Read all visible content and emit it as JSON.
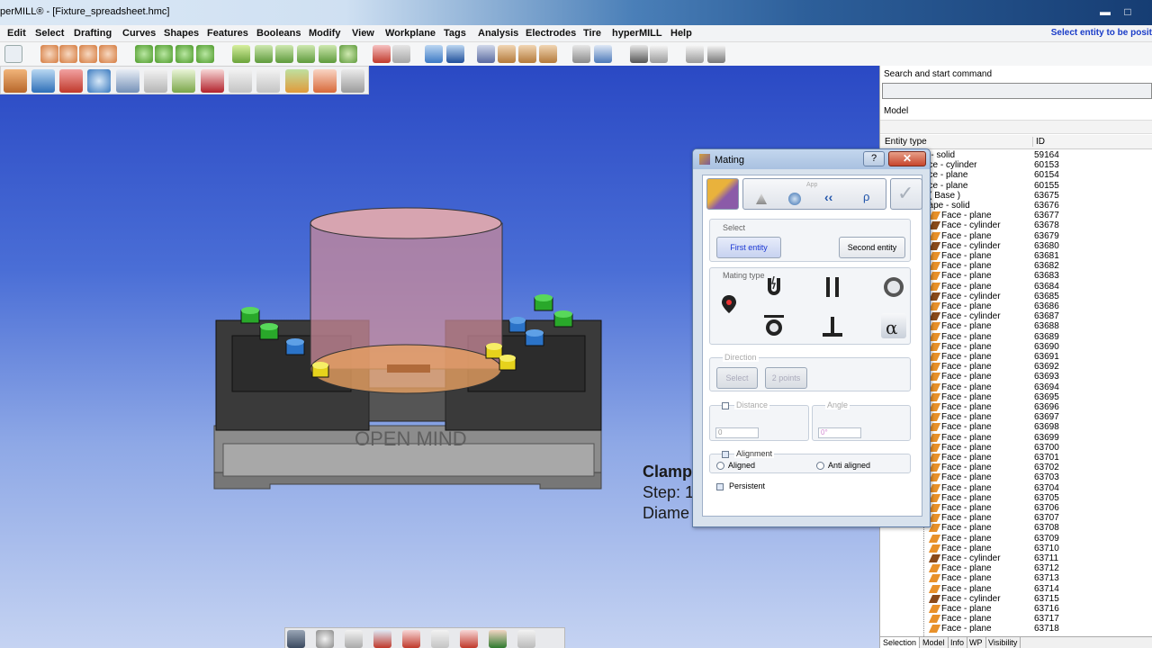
{
  "window": {
    "title": "perMILL® - [Fixture_spreadsheet.hmc]",
    "minimize": "▬",
    "maximize": "□"
  },
  "menu": {
    "items": [
      "Edit",
      "Select",
      "Drafting",
      "Curves",
      "Shapes",
      "Features",
      "Booleans",
      "Modify",
      "View",
      "Workplane",
      "Tags",
      "Analysis",
      "Electrodes",
      "Tire",
      "hyperMILL",
      "Help"
    ],
    "status_hint": "Select entity to be posit"
  },
  "viewport": {
    "model_text": "OPEN MIND",
    "overlay_lines": [
      "Clamp",
      "Step: 1",
      "Diame"
    ]
  },
  "right_panel": {
    "search_label": "Search and start command",
    "model_label": "Model",
    "columns": [
      "Entity type",
      "ID"
    ],
    "rows": [
      {
        "name": "e - solid",
        "id": "59164",
        "icon": "none"
      },
      {
        "name": "ace - cylinder",
        "id": "60153",
        "icon": "none"
      },
      {
        "name": "ace - plane",
        "id": "60154",
        "icon": "none"
      },
      {
        "name": "ace - plane",
        "id": "60155",
        "icon": "none"
      },
      {
        "name": ") ( Base )",
        "id": "63675",
        "icon": "none"
      },
      {
        "name": "hape - solid",
        "id": "63676",
        "icon": "none"
      },
      {
        "name": "Face - plane",
        "id": "63677",
        "icon": "plane"
      },
      {
        "name": "Face - cylinder",
        "id": "63678",
        "icon": "cylinder"
      },
      {
        "name": "Face - plane",
        "id": "63679",
        "icon": "plane"
      },
      {
        "name": "Face - cylinder",
        "id": "63680",
        "icon": "cylinder"
      },
      {
        "name": "Face - plane",
        "id": "63681",
        "icon": "plane"
      },
      {
        "name": "Face - plane",
        "id": "63682",
        "icon": "plane"
      },
      {
        "name": "Face - plane",
        "id": "63683",
        "icon": "plane"
      },
      {
        "name": "Face - plane",
        "id": "63684",
        "icon": "plane"
      },
      {
        "name": "Face - cylinder",
        "id": "63685",
        "icon": "cylinder"
      },
      {
        "name": "Face - plane",
        "id": "63686",
        "icon": "plane"
      },
      {
        "name": "Face - cylinder",
        "id": "63687",
        "icon": "cylinder"
      },
      {
        "name": "Face - plane",
        "id": "63688",
        "icon": "plane"
      },
      {
        "name": "Face - plane",
        "id": "63689",
        "icon": "plane"
      },
      {
        "name": "Face - plane",
        "id": "63690",
        "icon": "plane"
      },
      {
        "name": "Face - plane",
        "id": "63691",
        "icon": "plane"
      },
      {
        "name": "Face - plane",
        "id": "63692",
        "icon": "plane"
      },
      {
        "name": "Face - plane",
        "id": "63693",
        "icon": "plane"
      },
      {
        "name": "Face - plane",
        "id": "63694",
        "icon": "plane"
      },
      {
        "name": "Face - plane",
        "id": "63695",
        "icon": "plane"
      },
      {
        "name": "Face - plane",
        "id": "63696",
        "icon": "plane"
      },
      {
        "name": "Face - plane",
        "id": "63697",
        "icon": "plane"
      },
      {
        "name": "Face - plane",
        "id": "63698",
        "icon": "plane"
      },
      {
        "name": "Face - plane",
        "id": "63699",
        "icon": "plane"
      },
      {
        "name": "Face - plane",
        "id": "63700",
        "icon": "plane"
      },
      {
        "name": "Face - plane",
        "id": "63701",
        "icon": "plane"
      },
      {
        "name": "Face - plane",
        "id": "63702",
        "icon": "plane"
      },
      {
        "name": "Face - plane",
        "id": "63703",
        "icon": "plane"
      },
      {
        "name": "Face - plane",
        "id": "63704",
        "icon": "plane"
      },
      {
        "name": "Face - plane",
        "id": "63705",
        "icon": "plane"
      },
      {
        "name": "Face - plane",
        "id": "63706",
        "icon": "plane"
      },
      {
        "name": "Face - plane",
        "id": "63707",
        "icon": "plane"
      },
      {
        "name": "Face - plane",
        "id": "63708",
        "icon": "plane"
      },
      {
        "name": "Face - plane",
        "id": "63709",
        "icon": "plane"
      },
      {
        "name": "Face - plane",
        "id": "63710",
        "icon": "plane"
      },
      {
        "name": "Face - cylinder",
        "id": "63711",
        "icon": "cylinder"
      },
      {
        "name": "Face - plane",
        "id": "63712",
        "icon": "plane"
      },
      {
        "name": "Face - plane",
        "id": "63713",
        "icon": "plane"
      },
      {
        "name": "Face - plane",
        "id": "63714",
        "icon": "plane"
      },
      {
        "name": "Face - cylinder",
        "id": "63715",
        "icon": "cylinder"
      },
      {
        "name": "Face - plane",
        "id": "63716",
        "icon": "plane"
      },
      {
        "name": "Face - plane",
        "id": "63717",
        "icon": "plane"
      },
      {
        "name": "Face - plane",
        "id": "63718",
        "icon": "plane"
      }
    ],
    "tabs": [
      "Selection",
      "Model",
      "Info",
      "WP",
      "Visibility"
    ]
  },
  "dialog": {
    "title": "Mating",
    "help": "?",
    "close": "✕",
    "toolbar_hint": "App",
    "select_group": "Select",
    "first_entity": "First entity",
    "second_entity": "Second entity",
    "mating_type_group": "Mating type",
    "direction_group": "Direction",
    "direction_select": "Select",
    "direction_two_points": "2 points",
    "distance_label": "Distance",
    "distance_value": "0",
    "angle_label": "Angle",
    "angle_value": "0°",
    "alignment_group": "Alignment",
    "aligned": "Aligned",
    "anti_aligned": "Anti aligned",
    "persistent": "Persistent",
    "mating_type_symbol_alpha": "α"
  },
  "colors": {
    "accent_link": "#1a3cc8",
    "plane_icon": "#e8912a",
    "cylinder_icon": "#8a4a1a",
    "viewport_top": "#2a49c4",
    "dialog_close": "#c7452c"
  }
}
